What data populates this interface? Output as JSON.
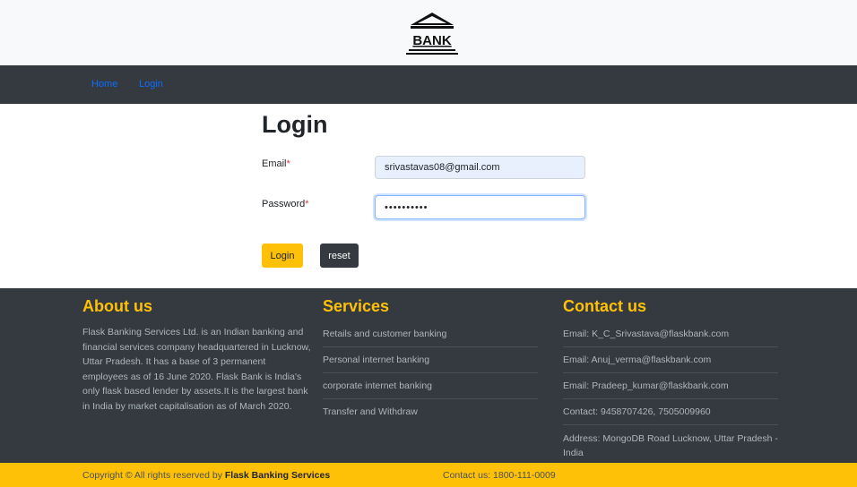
{
  "logo": {
    "text": "BANK",
    "icon": "bank-building-icon"
  },
  "nav": {
    "home": "Home",
    "login": "Login"
  },
  "form": {
    "title": "Login",
    "email_label": "Email",
    "password_label": "Password",
    "required_mark": "*",
    "email_value": "srivastavas08@gmail.com",
    "password_value": "••••••••••",
    "login_button": "Login",
    "reset_button": "reset"
  },
  "footer": {
    "about_title": "About us",
    "about_text": "Flask Banking Services Ltd. is an Indian banking and financial services company headquartered in Lucknow, Uttar Pradesh. It has a base of 3 permanent employees as of 16 June 2020. Flask Bank is India's only flask based lender by assets.It is the largest bank in India by market capitalisation as of March 2020.",
    "services_title": "Services",
    "services": [
      "Retails and customer banking",
      "Personal internet banking",
      "corporate internet banking",
      "Transfer and Withdraw"
    ],
    "contact_title": "Contact us",
    "contacts": [
      "Email: K_C_Srivastava@flaskbank.com",
      "Email: Anuj_verma@flaskbank.com",
      "Email: Pradeep_kumar@flaskbank.com",
      "Contact: 9458707426, 7505009960",
      "Address: MongoDB Road Lucknow, Uttar Pradesh - India"
    ]
  },
  "bottom": {
    "copyright_prefix": "Copyright © All rights reserved by ",
    "copyright_brand": "Flask Banking Services",
    "contact": "Contact us: 1800-111-0009"
  },
  "colors": {
    "accent": "#ffc107",
    "dark": "#343a40",
    "link": "#0d6efd"
  }
}
